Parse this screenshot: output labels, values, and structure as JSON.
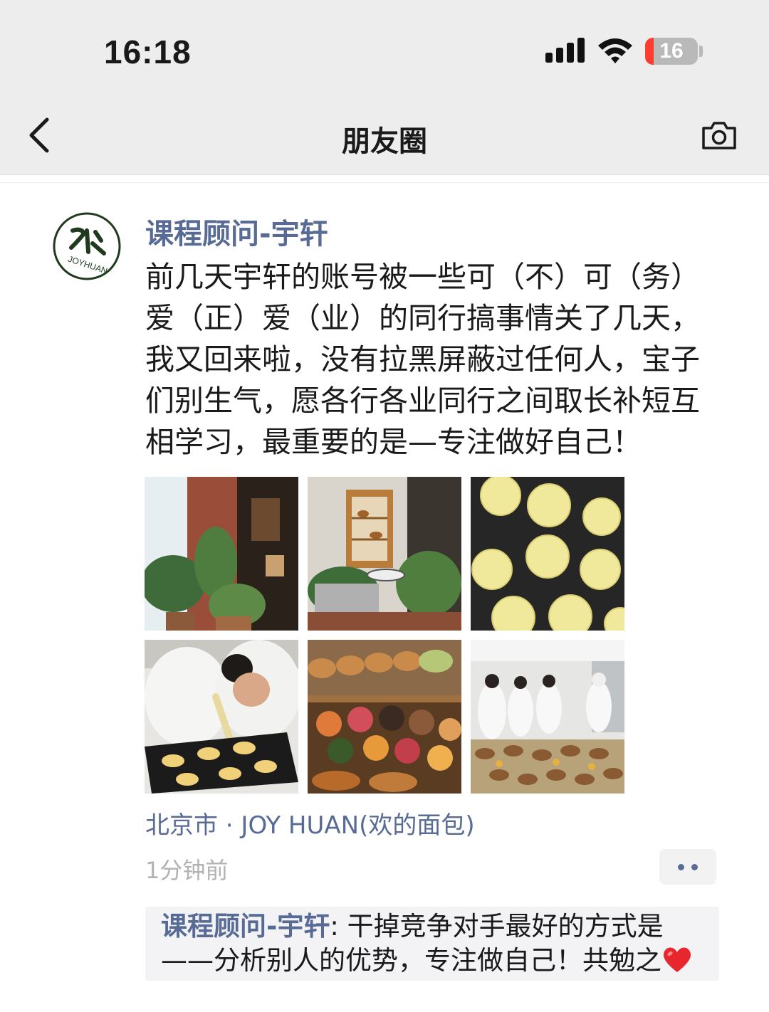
{
  "status_bar": {
    "time": "16:18",
    "battery": "16",
    "battery_level_percent": 16,
    "battery_color": "#ff3b30"
  },
  "nav": {
    "back_icon": "chevron-left-icon",
    "title": "朋友圈",
    "camera_icon": "camera-icon"
  },
  "post": {
    "author": "课程顾问-宇轩",
    "avatar_text": "JOYHUAN",
    "text": "前几天宇轩的账号被一些可（不）可（务）爱（正）爱（业）的同行搞事情关了几天，我又回来啦，没有拉黑屏蔽过任何人，宝子们别生气，愿各行各业同行之间取长补短互相学习，最重要的是—专注做好自己！",
    "images": [
      {
        "name": "photo-plants-shop",
        "icon": "photo"
      },
      {
        "name": "photo-bread-cabinet",
        "icon": "photo"
      },
      {
        "name": "photo-tarts-tray",
        "icon": "photo"
      },
      {
        "name": "photo-baker-piping",
        "icon": "photo"
      },
      {
        "name": "photo-bread-display",
        "icon": "photo"
      },
      {
        "name": "photo-bakery-class",
        "icon": "photo"
      }
    ],
    "location": "北京市 · JOY HUAN(欢的面包)",
    "time_ago": "1分钟前",
    "more_icon": "more-dots-icon"
  },
  "comment": {
    "author": "课程顾问-宇轩",
    "separator": ": ",
    "text": "干掉竞争对手最好的方式是——分析别人的优势，专注做自己！共勉之",
    "emoji": "heart-icon"
  },
  "colors": {
    "link": "#576b95",
    "header_bg": "#ededed",
    "comment_bg": "#f3f3f5"
  }
}
